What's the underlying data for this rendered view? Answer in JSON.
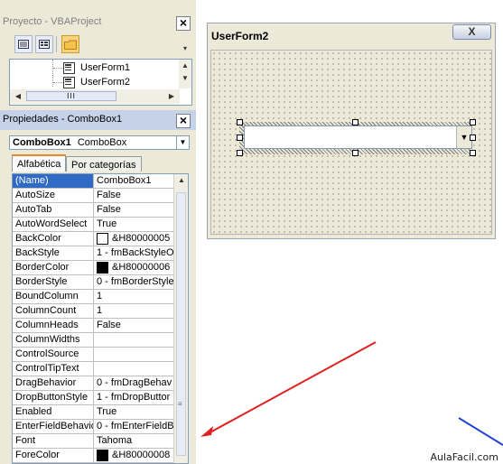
{
  "project_panel": {
    "title": "Proyecto - VBAProject",
    "tree_items": [
      {
        "label": "UserForm1"
      },
      {
        "label": "UserForm2"
      }
    ],
    "scroll_grip": "III"
  },
  "properties_panel": {
    "title": "Propiedades - ComboBox1",
    "object_name": "ComboBox1",
    "object_type": "ComboBox",
    "tabs": [
      "Alfabética",
      "Por categorías"
    ],
    "properties": [
      {
        "name": "(Name)",
        "value": "ComboBox1",
        "selected": true
      },
      {
        "name": "AutoSize",
        "value": "False"
      },
      {
        "name": "AutoTab",
        "value": "False"
      },
      {
        "name": "AutoWordSelect",
        "value": "True"
      },
      {
        "name": "BackColor",
        "value": "&H80000005",
        "swatch": "#ffffff"
      },
      {
        "name": "BackStyle",
        "value": "1 - fmBackStyleO"
      },
      {
        "name": "BorderColor",
        "value": "&H80000006",
        "swatch": "#000000"
      },
      {
        "name": "BorderStyle",
        "value": "0 - fmBorderStyle"
      },
      {
        "name": "BoundColumn",
        "value": "1"
      },
      {
        "name": "ColumnCount",
        "value": "1"
      },
      {
        "name": "ColumnHeads",
        "value": "False"
      },
      {
        "name": "ColumnWidths",
        "value": ""
      },
      {
        "name": "ControlSource",
        "value": ""
      },
      {
        "name": "ControlTipText",
        "value": ""
      },
      {
        "name": "DragBehavior",
        "value": "0 - fmDragBehav"
      },
      {
        "name": "DropButtonStyle",
        "value": "1 - fmDropButtor"
      },
      {
        "name": "Enabled",
        "value": "True"
      },
      {
        "name": "EnterFieldBehavior",
        "value": "0 - fmEnterFieldB"
      },
      {
        "name": "Font",
        "value": "Tahoma"
      },
      {
        "name": "ForeColor",
        "value": "&H80000008",
        "swatch": "#000000"
      }
    ]
  },
  "form_designer": {
    "title": "UserForm2",
    "close_glyph": "X"
  },
  "watermark": "AulaFacil.com",
  "colors": {
    "selection": "#316ac5",
    "annotation_arrow": "#e02020",
    "annotation_line": "#1f3fd6"
  }
}
